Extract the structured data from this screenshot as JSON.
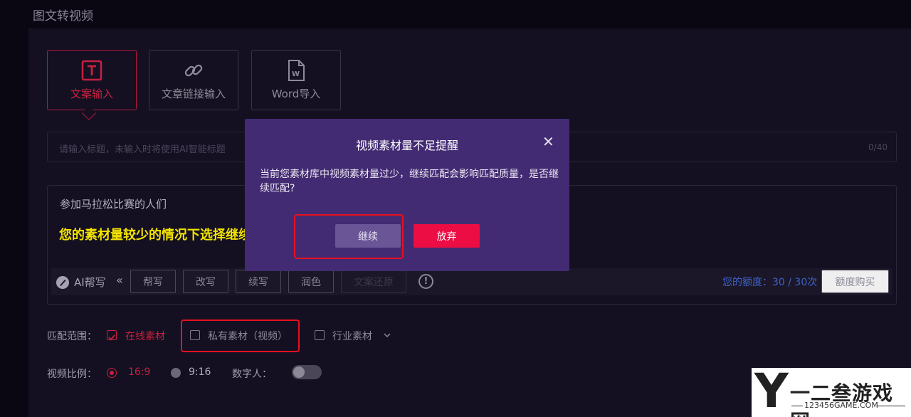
{
  "page": {
    "title": "图文转视频"
  },
  "input_tabs": [
    {
      "label": "文案输入",
      "icon": "text-t-icon",
      "active": true
    },
    {
      "label": "文章链接输入",
      "icon": "link-icon",
      "active": false
    },
    {
      "label": "Word导入",
      "icon": "word-doc-icon",
      "active": false
    }
  ],
  "title_input": {
    "placeholder": "请输入标题，未输入时将使用AI智能标题",
    "counter": "0/40"
  },
  "editor": {
    "title": "参加马拉松比赛的人们",
    "annotation": "您的素材量较少的情况下选择继续即可"
  },
  "ai_toolbar": {
    "label": "AI帮写",
    "collapse": "«",
    "buttons": [
      "帮写",
      "改写",
      "续写",
      "润色"
    ],
    "restore": "文案还原",
    "quota_label": "您的额度：",
    "quota_value": "30 / 30次",
    "buy": "额度购买"
  },
  "match_scope": {
    "label": "匹配范围：",
    "options": [
      {
        "label": "在线素材",
        "checked": true
      },
      {
        "label": "私有素材（视频）",
        "checked": false
      },
      {
        "label": "行业素材",
        "checked": false
      }
    ]
  },
  "video_ratio": {
    "label": "视频比例：",
    "options": [
      {
        "label": "16:9",
        "selected": true
      },
      {
        "label": "9:16",
        "selected": false
      }
    ],
    "digital_human_label": "数字人：",
    "digital_human_on": false
  },
  "modal": {
    "title": "视频素材量不足提醒",
    "body": "当前您素材库中视频素材量过少，继续匹配会影响匹配质量，是否继续匹配?",
    "continue": "继续",
    "abandon": "放弃"
  },
  "watermark": {
    "logo": "Y",
    "text": "一二叁游戏网",
    "url": "123456GAME.COM"
  },
  "colors": {
    "accent": "#c8203f",
    "modal_bg": "#432b73",
    "abandon": "#ec0d45",
    "annotation": "#f3e300",
    "highlight": "#e8101e"
  }
}
